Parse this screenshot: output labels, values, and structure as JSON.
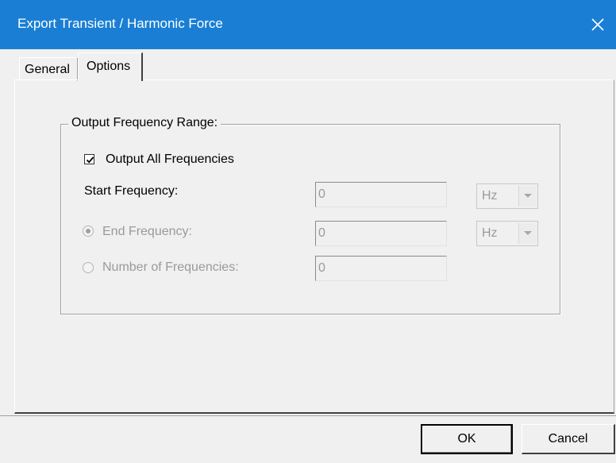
{
  "window": {
    "title": "Export Transient / Harmonic Force",
    "close_icon": "close-icon",
    "titlebar_color": "#1a7fd4"
  },
  "tabs": [
    {
      "label": "General",
      "active": false
    },
    {
      "label": "Options",
      "active": true
    }
  ],
  "output_frequency_range": {
    "title": "Output Frequency Range:",
    "output_all": {
      "label": "Output All Frequencies",
      "checked": true
    },
    "start_frequency": {
      "label": "Start Frequency:",
      "value": "0",
      "unit": "Hz",
      "enabled": false
    },
    "end_frequency": {
      "label": "End Frequency:",
      "value": "0",
      "unit": "Hz",
      "selected": true,
      "enabled": false
    },
    "number_of_frequencies": {
      "label": "Number of Frequencies:",
      "value": "0",
      "selected": false,
      "enabled": false
    }
  },
  "buttons": {
    "ok": "OK",
    "cancel": "Cancel"
  }
}
